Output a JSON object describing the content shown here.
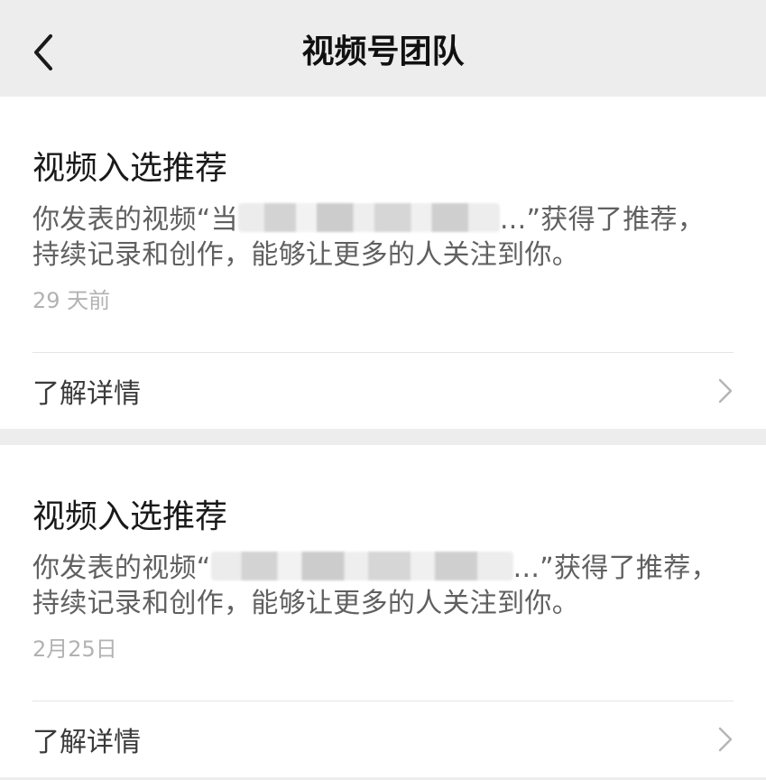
{
  "header": {
    "title": "视频号团队",
    "back_icon": "chevron-left-icon"
  },
  "cards": [
    {
      "title": "视频入选推荐",
      "body_prefix": "你发表的视频“当",
      "body_suffix": "...”获得了推荐，",
      "body_line2": "持续记录和创作，能够让更多的人关注到你。",
      "time": "29 天前",
      "detail_label": "了解详情",
      "detail_icon": "chevron-right-icon"
    },
    {
      "title": "视频入选推荐",
      "body_prefix": "你发表的视频“",
      "body_suffix": "...”获得了推荐，",
      "body_line2": "持续记录和创作，能够让更多的人关注到你。",
      "time": "2月25日",
      "detail_label": "了解详情",
      "detail_icon": "chevron-right-icon"
    }
  ],
  "colors": {
    "background": "#ededed",
    "card": "#ffffff",
    "title": "#191919",
    "body": "#606060",
    "time": "#b2b2b2",
    "divider": "#e5e5e5"
  }
}
